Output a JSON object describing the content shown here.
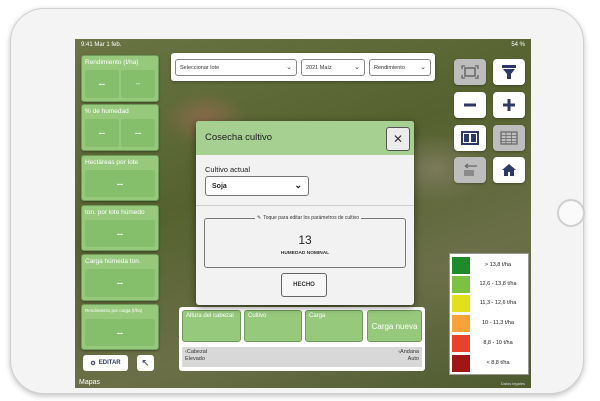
{
  "status": {
    "time": "9:41",
    "date": "Mar 1 feb.",
    "battery": "54 %"
  },
  "metrics": [
    {
      "title": "Rendimiento (t/ha)",
      "values": [
        "-- ",
        "--"
      ]
    },
    {
      "title": "% de humedad",
      "values": [
        "--",
        "--"
      ]
    },
    {
      "title": "Hectáreas por lote",
      "values": [
        "--"
      ]
    },
    {
      "title": "ton. por lote húmedo",
      "values": [
        "--"
      ]
    },
    {
      "title": "Carga húmeda ton.",
      "values": [
        "--"
      ]
    },
    {
      "title": "Rendimiento por carga (t/ha)",
      "values": [
        "--"
      ]
    }
  ],
  "edit_label": "EDITAR",
  "topbar": {
    "lot_placeholder": "Seleccionar lote",
    "season": "2021 Maíz",
    "layer": "Rendimiento"
  },
  "tools": [
    "fit-to-screen-icon",
    "layer-funnel-icon",
    "zoom-out-icon",
    "zoom-in-icon",
    "split-view-icon",
    "table-icon",
    "swap-icon",
    "home-icon"
  ],
  "legend": [
    {
      "label": "> 13,8 t/ha",
      "color": "#1e8a2a"
    },
    {
      "label": "12,6 - 13,8 t/ha",
      "color": "#7cc242"
    },
    {
      "label": "11,3 - 12,6 t/ha",
      "color": "#e2e01a"
    },
    {
      "label": "10 - 11,3 t/ha",
      "color": "#f7a33a"
    },
    {
      "label": "8,8 - 10 t/ha",
      "color": "#e6432a"
    },
    {
      "label": "< 8,8 t/ha",
      "color": "#a01616"
    }
  ],
  "bottom": {
    "cards": [
      "Altura del cabezal",
      "Cultivo",
      "Carga"
    ],
    "new_load": "Carga nueva",
    "left_title": "Cabezal",
    "left_sub": "Elevado",
    "right_title": "Andana",
    "right_sub": "Auto"
  },
  "modal": {
    "title": "Cosecha cultivo",
    "current_crop_label": "Cultivo actual",
    "current_crop": "Soja",
    "hint": "Toque para editar los parámetros de cultivo",
    "param_value": "13",
    "param_name": "HUMEDAD NOMINAL",
    "done": "HECHO"
  },
  "map_label": "Mapas",
  "legal": "Datos legales"
}
